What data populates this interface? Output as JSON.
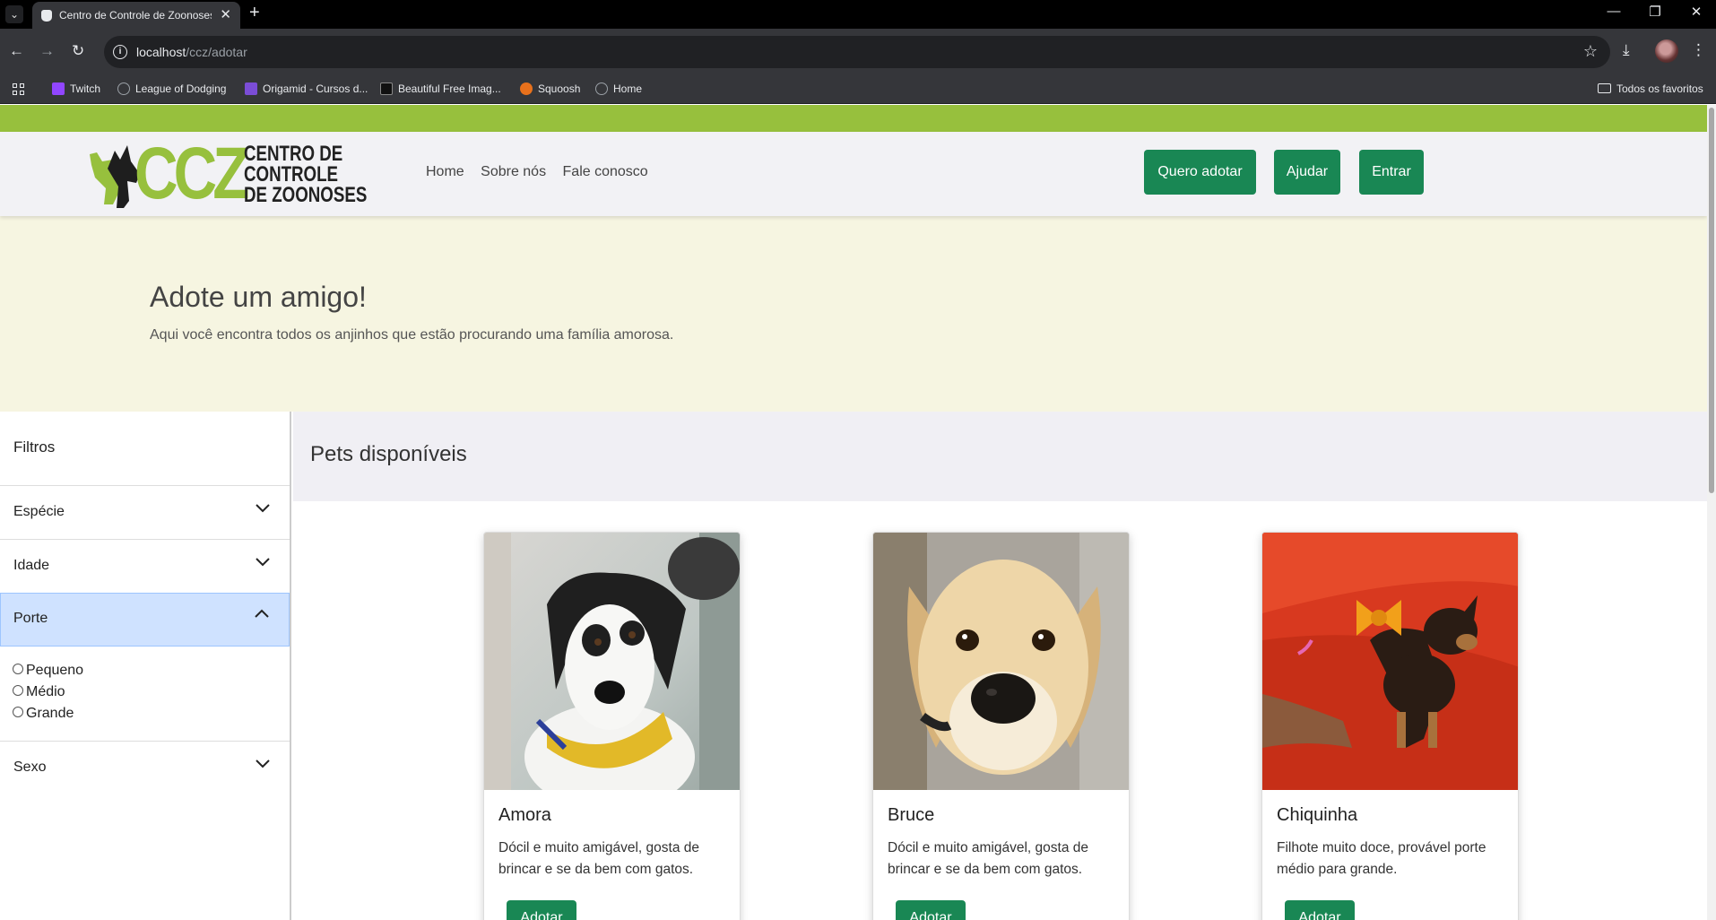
{
  "browser": {
    "tab_title": "Centro de Controle de Zoonoses",
    "url_host": "localhost",
    "url_path": "/ccz/adotar",
    "bookmarks": [
      {
        "label": "Twitch",
        "color": "#9146ff"
      },
      {
        "label": "League of Dodging",
        "color": "#9aa0a6"
      },
      {
        "label": "Origamid - Cursos d...",
        "color": "#7b4dd6"
      },
      {
        "label": "Beautiful Free Imag...",
        "color": "#111111"
      },
      {
        "label": "Squoosh",
        "color": "#e8711c"
      },
      {
        "label": "Home",
        "color": "#9aa0a6"
      }
    ],
    "all_bookmarks": "Todos os favoritos"
  },
  "colors": {
    "brand_green": "#97c03d",
    "button_green": "#198754",
    "hero_bg": "#f6f5e1",
    "active_filter": "#cfe2ff"
  },
  "header": {
    "logo_mark": "CCZ",
    "logo_lines": [
      "CENTRO DE",
      "CONTROLE",
      "DE ZOONOSES"
    ],
    "nav": [
      "Home",
      "Sobre nós",
      "Fale conosco"
    ],
    "buttons": {
      "adopt": "Quero adotar",
      "help": "Ajudar",
      "login": "Entrar"
    }
  },
  "hero": {
    "title": "Adote um amigo!",
    "subtitle": "Aqui você encontra todos os anjinhos que estão procurando uma família amorosa."
  },
  "filters": {
    "title": "Filtros",
    "sections": [
      "Espécie",
      "Idade",
      "Porte",
      "Sexo"
    ],
    "open_section": "Porte",
    "porte_options": [
      "Pequeno",
      "Médio",
      "Grande"
    ]
  },
  "pets": {
    "title": "Pets disponíveis",
    "items": [
      {
        "name": "Amora",
        "description": "Dócil e muito amigável, gosta de brincar e se da bem com gatos.",
        "button": "Adotar"
      },
      {
        "name": "Bruce",
        "description": "Dócil e muito amigável, gosta de brincar e se da bem com gatos.",
        "button": "Adotar"
      },
      {
        "name": "Chiquinha",
        "description": "Filhote muito doce, provável porte médio para grande.",
        "button": "Adotar"
      }
    ]
  }
}
